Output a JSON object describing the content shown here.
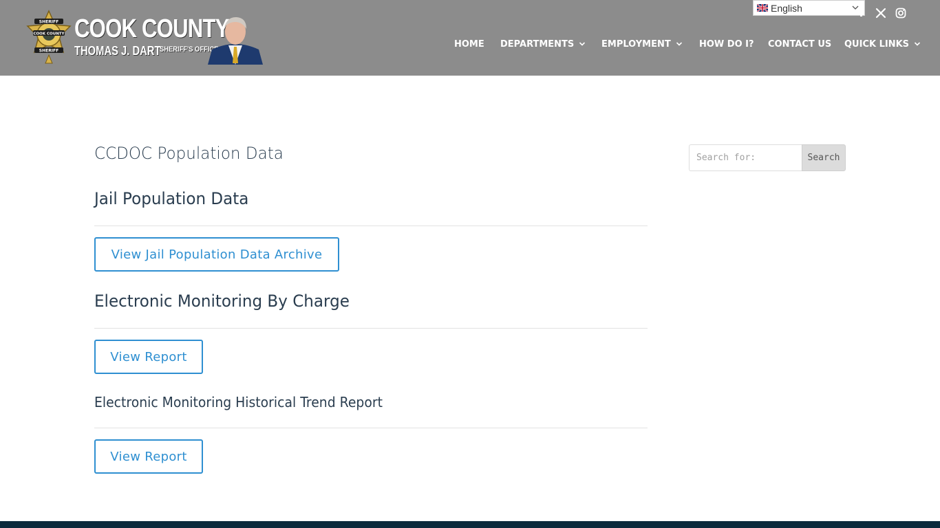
{
  "header": {
    "logo": {
      "title": "COOK COUNTY",
      "subtitle": "THOMAS J. DART",
      "office": "SHERIFF'S OFFICE",
      "badge_top": "SHERIFF",
      "badge_mid": "COOK COUNTY",
      "badge_bottom": "SHERIFF"
    },
    "language": {
      "selected": "English"
    },
    "social": [
      {
        "icon": "x-twitter-icon"
      },
      {
        "icon": "instagram-icon"
      }
    ],
    "nav": [
      {
        "label": "HOME",
        "dropdown": false
      },
      {
        "label": "DEPARTMENTS",
        "dropdown": true
      },
      {
        "label": "EMPLOYMENT",
        "dropdown": true
      },
      {
        "label": "HOW DO I?",
        "dropdown": false
      },
      {
        "label": "CONTACT US",
        "dropdown": false
      },
      {
        "label": "QUICK LINKS",
        "dropdown": true
      }
    ]
  },
  "main": {
    "page_title": "CCDOC Population Data",
    "sections": [
      {
        "heading": "Jail Population Data",
        "button": "View Jail Population Data Archive"
      },
      {
        "heading": "Electronic Monitoring By Charge",
        "button": "View Report"
      },
      {
        "heading": "Electronic Monitoring Historical Trend Report",
        "button": "View Report"
      }
    ]
  },
  "sidebar": {
    "search": {
      "placeholder": "Search for:",
      "button": "Search"
    }
  },
  "colors": {
    "header_bg": "#8c8c8c",
    "accent": "#2e8fd1",
    "text": "#2a3d4f",
    "footer": "#0c2a3c"
  }
}
